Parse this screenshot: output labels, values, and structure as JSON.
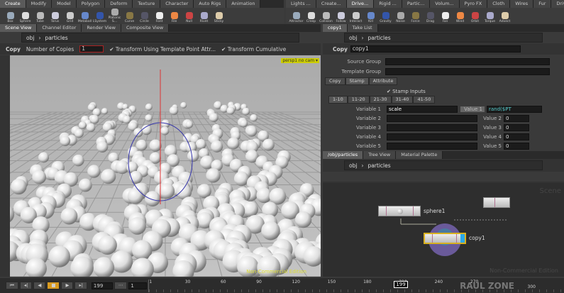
{
  "shelf": {
    "tabs_left": [
      "Create",
      "Modify",
      "Model",
      "Polygon",
      "Deform",
      "Texture",
      "Character",
      "Auto Rigs",
      "Animation"
    ],
    "tools_left": [
      "Box",
      "Sphere",
      "Tube",
      "Torus",
      "Grid",
      "Metaball",
      "LSystem",
      "Platonic S...",
      "Curve",
      "Circle",
      "Font",
      "File",
      "Null",
      "Rivet",
      "Sticky"
    ],
    "tabs_right": [
      "Lights ...",
      "Create...",
      "Drive...",
      "Rigid ...",
      "Partic...",
      "Volum...",
      "Pyro FX",
      "Cloth",
      "Wires",
      "Fur",
      "Drive ..."
    ],
    "tools_right": [
      "Attractor",
      "Creep",
      "Collision",
      "Follow",
      "Interact",
      "Kill",
      "Gravity",
      "Noise",
      "Force",
      "Drag",
      "Fan",
      "Wind",
      "Orbit",
      "Torque",
      "Advect"
    ]
  },
  "left_pane": {
    "tabs": [
      "Scene View",
      "Channel Editor",
      "Render View",
      "Composite View"
    ],
    "path": [
      "obj",
      "particles"
    ],
    "op_label": "Copy",
    "num_copies_label": "Number of Copies",
    "num_copies": "1",
    "transform_template": "Transform Using Template Point Attr...",
    "transform_cumulative": "Transform Cumulative",
    "persp": "persp1 ▾",
    "cam": "no cam ▾",
    "watermark": "Non-Commercial Edition"
  },
  "params": {
    "tabs": [
      "copy1",
      "Take List"
    ],
    "path": [
      "obj",
      "particles"
    ],
    "op_type": "Copy",
    "op_name": "copy1",
    "source_group": "Source Group",
    "template_group": "Template Group",
    "sub_tabs": [
      "Copy",
      "Stamp",
      "Attribute"
    ],
    "stamp_inputs": "Stamp Inputs",
    "range_tabs": [
      "1-10",
      "11-20",
      "21-30",
      "31-40",
      "41-50"
    ],
    "variables": [
      {
        "label": "Variable 1",
        "value": "scale",
        "vlabel": "Value 1",
        "val": "rand($PT"
      },
      {
        "label": "Variable 2",
        "value": "",
        "vlabel": "Value 2",
        "val": "0"
      },
      {
        "label": "Variable 3",
        "value": "",
        "vlabel": "Value 3",
        "val": "0"
      },
      {
        "label": "Variable 4",
        "value": "",
        "vlabel": "Value 4",
        "val": "0"
      },
      {
        "label": "Variable 5",
        "value": "",
        "vlabel": "Value 5",
        "val": "0"
      }
    ]
  },
  "network": {
    "tabs": [
      "/obj/particles",
      "Tree View",
      "Material Palette"
    ],
    "path": [
      "obj",
      "particles"
    ],
    "context": "Scene",
    "nodes": {
      "sphere": "sphere1",
      "copy": "copy1"
    },
    "watermark": "Non-Commercial Edition"
  },
  "timeline": {
    "frame": "199",
    "start": "1",
    "ticks_left": [
      "1",
      "30",
      "60",
      "90",
      "120",
      "150"
    ],
    "ticks_right": [
      "180",
      "210",
      "240",
      "270"
    ],
    "current": "199",
    "end": "300",
    "logo": "RAUL ZONE"
  }
}
